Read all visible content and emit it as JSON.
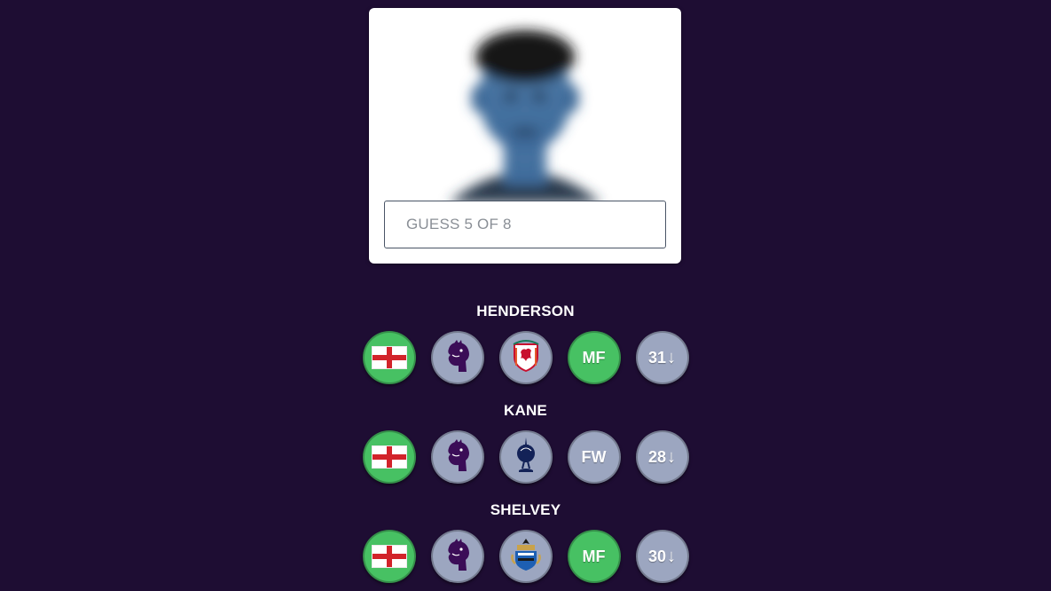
{
  "search": {
    "placeholder": "GUESS 5 OF 8"
  },
  "colors": {
    "background": "#1e0d33",
    "correct": "#47c163",
    "incorrect": "#9ca6c0"
  },
  "guesses": [
    {
      "name": "HENDERSON",
      "nationality": {
        "icon": "england-flag-icon",
        "status": "correct"
      },
      "league": {
        "icon": "premier-league-lion-icon",
        "status": "incorrect"
      },
      "club": {
        "icon": "liverpool-crest-icon",
        "status": "incorrect"
      },
      "position": {
        "value": "MF",
        "status": "correct"
      },
      "age": {
        "value": "31",
        "arrow": "↓",
        "status": "incorrect"
      }
    },
    {
      "name": "KANE",
      "nationality": {
        "icon": "england-flag-icon",
        "status": "correct"
      },
      "league": {
        "icon": "premier-league-lion-icon",
        "status": "incorrect"
      },
      "club": {
        "icon": "tottenham-crest-icon",
        "status": "incorrect"
      },
      "position": {
        "value": "FW",
        "status": "incorrect"
      },
      "age": {
        "value": "28",
        "arrow": "↓",
        "status": "incorrect"
      }
    },
    {
      "name": "SHELVEY",
      "nationality": {
        "icon": "england-flag-icon",
        "status": "correct"
      },
      "league": {
        "icon": "premier-league-lion-icon",
        "status": "incorrect"
      },
      "club": {
        "icon": "newcastle-crest-icon",
        "status": "incorrect"
      },
      "position": {
        "value": "MF",
        "status": "correct"
      },
      "age": {
        "value": "30",
        "arrow": "↓",
        "status": "incorrect"
      }
    }
  ]
}
